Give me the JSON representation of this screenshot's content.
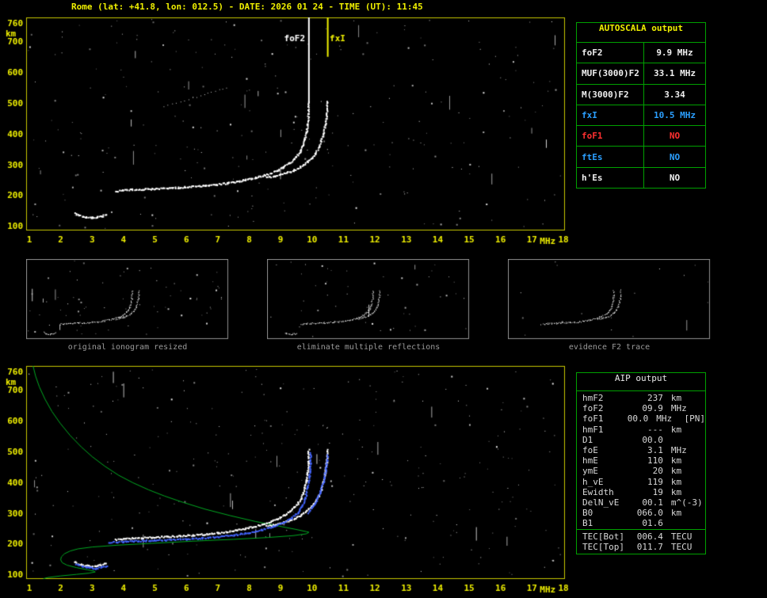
{
  "header": {
    "title": "Rome (lat: +41.8, lon: 012.5) - DATE: 2026 01 24 - TIME (UT): 11:45"
  },
  "panels": {
    "captions": [
      "original ionogram resized",
      "eliminate multiple reflections",
      "evidence F2 trace"
    ]
  },
  "autoscala_table": {
    "title": "AUTOSCALA output",
    "rows": [
      {
        "label": "foF2",
        "value": "9.9 MHz",
        "color": "#f0f0f0"
      },
      {
        "label": "MUF(3000)F2",
        "value": "33.1 MHz",
        "color": "#f0f0f0"
      },
      {
        "label": "M(3000)F2",
        "value": "3.34",
        "color": "#f0f0f0"
      },
      {
        "label": "fxI",
        "value": "10.5 MHz",
        "color": "#2b9fff"
      },
      {
        "label": "foF1",
        "value": "NO",
        "color": "#ff3030"
      },
      {
        "label": "ftEs",
        "value": "NO",
        "color": "#2b9fff"
      },
      {
        "label": "h'Es",
        "value": "NO",
        "color": "#f0f0f0"
      }
    ]
  },
  "aip_table": {
    "title": "AIP output",
    "rows": [
      {
        "label": "hmF2",
        "value": "237",
        "unit": "km"
      },
      {
        "label": "foF2",
        "value": "09.9",
        "unit": "MHz"
      },
      {
        "label": "foF1",
        "value": "00.0",
        "unit": "MHz",
        "extra": "[PN]"
      },
      {
        "label": "hmF1",
        "value": "---",
        "unit": "km"
      },
      {
        "label": "D1",
        "value": "00.0",
        "unit": ""
      },
      {
        "label": "foE",
        "value": "3.1",
        "unit": "MHz"
      },
      {
        "label": "hmE",
        "value": "110",
        "unit": "km"
      },
      {
        "label": "ymE",
        "value": "20",
        "unit": "km"
      },
      {
        "label": "h_vE",
        "value": "119",
        "unit": "km"
      },
      {
        "label": "Ewidth",
        "value": "19",
        "unit": "km"
      },
      {
        "label": "DelN_vE",
        "value": "00.1",
        "unit": "m^(-3)"
      },
      {
        "label": "B0",
        "value": "066.0",
        "unit": "km"
      },
      {
        "label": "B1",
        "value": "01.6",
        "unit": ""
      },
      {
        "label": "TEC[Bot]",
        "value": "006.4",
        "unit": "TECU"
      },
      {
        "label": "TEC[Top]",
        "value": "011.7",
        "unit": "TECU"
      }
    ]
  },
  "chart_data": [
    {
      "id": "main-ionogram",
      "type": "scatter",
      "title": "",
      "xlabel": "MHz",
      "ylabel": "km",
      "xlim": [
        0.9,
        18.05
      ],
      "ylim": [
        85,
        778
      ],
      "x_ticks": [
        1,
        2,
        3,
        4,
        5,
        6,
        7,
        8,
        9,
        10,
        11,
        12,
        13,
        14,
        15,
        16,
        17,
        18
      ],
      "y_ticks": [
        100,
        200,
        300,
        400,
        500,
        600,
        700,
        760
      ],
      "frame_color": "#c8c800",
      "noise": {
        "dots": 265,
        "dashes": 16,
        "seed": 11
      },
      "vlines": [
        {
          "f": 9.9,
          "km0": 500,
          "km1": 778,
          "color": "#ffffff",
          "w": 2
        },
        {
          "f": 10.5,
          "km0": 650,
          "km1": 778,
          "color": "#f0f000",
          "w": 2
        }
      ],
      "annotations": [
        {
          "text": "foF2",
          "f": 9.78,
          "km": 710,
          "color": "#ffffff",
          "align": "right"
        },
        {
          "text": "fxI",
          "f": 10.56,
          "km": 710,
          "color": "#f0f000",
          "align": "left"
        }
      ],
      "traces": [
        {
          "name": "F2-O",
          "color": "#ffffff",
          "width": 2,
          "step": 1.6,
          "points": [
            [
              3.75,
              212
            ],
            [
              4.0,
              215
            ],
            [
              4.3,
              217
            ],
            [
              4.6,
              218
            ],
            [
              5.0,
              220
            ],
            [
              5.4,
              222
            ],
            [
              5.8,
              224
            ],
            [
              6.2,
              227
            ],
            [
              6.6,
              230
            ],
            [
              7.0,
              234
            ],
            [
              7.3,
              238
            ],
            [
              7.6,
              243
            ],
            [
              7.9,
              249
            ],
            [
              8.2,
              256
            ],
            [
              8.5,
              264
            ],
            [
              8.7,
              271
            ],
            [
              8.9,
              280
            ],
            [
              9.1,
              291
            ],
            [
              9.3,
              305
            ],
            [
              9.45,
              318
            ],
            [
              9.55,
              330
            ],
            [
              9.65,
              345
            ],
            [
              9.72,
              362
            ],
            [
              9.78,
              382
            ],
            [
              9.83,
              405
            ],
            [
              9.87,
              432
            ],
            [
              9.89,
              462
            ],
            [
              9.9,
              505
            ]
          ]
        },
        {
          "name": "F2-X",
          "color": "#ffffff",
          "width": 2,
          "step": 1.6,
          "points": [
            [
              8.55,
              256
            ],
            [
              8.8,
              261
            ],
            [
              9.0,
              266
            ],
            [
              9.2,
              272
            ],
            [
              9.45,
              281
            ],
            [
              9.65,
              292
            ],
            [
              9.85,
              306
            ],
            [
              10.0,
              320
            ],
            [
              10.12,
              336
            ],
            [
              10.22,
              355
            ],
            [
              10.3,
              376
            ],
            [
              10.37,
              400
            ],
            [
              10.43,
              430
            ],
            [
              10.47,
              462
            ],
            [
              10.5,
              505
            ]
          ]
        },
        {
          "name": "Es",
          "color": "#ffffff",
          "width": 2,
          "step": 1.6,
          "points": [
            [
              2.45,
              140
            ],
            [
              2.6,
              133
            ],
            [
              2.8,
              128
            ],
            [
              3.0,
              126
            ],
            [
              3.15,
              127
            ],
            [
              3.3,
              130
            ],
            [
              3.45,
              136
            ]
          ]
        },
        {
          "name": "spread",
          "color": "#c8c8c8",
          "width": 1,
          "step": 5,
          "points": [
            [
              5.3,
              487
            ],
            [
              6.2,
              516
            ],
            [
              7.3,
              549
            ]
          ]
        }
      ]
    },
    {
      "id": "resized-ionogram",
      "type": "scatter",
      "xlim": [
        0.9,
        18.05
      ],
      "ylim": [
        85,
        778
      ],
      "frame_color": "#909090",
      "trace_width": 1,
      "noise": {
        "dots": 70,
        "dashes": 4,
        "seed": 41
      },
      "traces_from": 0,
      "trace_names": [
        "F2-O",
        "F2-X",
        "Es"
      ]
    },
    {
      "id": "filtered-ionogram",
      "type": "scatter",
      "xlim": [
        0.9,
        18.05
      ],
      "ylim": [
        85,
        778
      ],
      "frame_color": "#909090",
      "trace_width": 1,
      "noise": {
        "dots": 48,
        "dashes": 2,
        "seed": 42
      },
      "traces_from": 0,
      "trace_names": [
        "F2-O",
        "F2-X",
        "Es"
      ]
    },
    {
      "id": "f2-evidence-ionogram",
      "type": "scatter",
      "xlim": [
        0.9,
        18.05
      ],
      "ylim": [
        85,
        778
      ],
      "frame_color": "#909090",
      "trace_width": 1,
      "noise": {
        "dots": 16,
        "dashes": 1,
        "seed": 43
      },
      "traces_from": 0,
      "trace_names": [
        "F2-O",
        "F2-X"
      ]
    },
    {
      "id": "profile-ionogram",
      "type": "scatter",
      "title": "",
      "xlabel": "MHz",
      "ylabel": "km",
      "xlim": [
        0.9,
        18.05
      ],
      "ylim": [
        85,
        778
      ],
      "x_ticks": [
        1,
        2,
        3,
        4,
        5,
        6,
        7,
        8,
        9,
        10,
        11,
        12,
        13,
        14,
        15,
        16,
        17,
        18
      ],
      "y_ticks": [
        100,
        200,
        300,
        400,
        500,
        600,
        700,
        760
      ],
      "frame_color": "#c8c800",
      "noise": {
        "dots": 295,
        "dashes": 14,
        "seed": 77
      },
      "traces_from": 0,
      "trace_names": [
        "F2-O",
        "F2-X",
        "Es"
      ],
      "traces": [
        {
          "name": "fit-O",
          "color": "#4466ff",
          "width": 2,
          "step": 1.6,
          "points": [
            [
              3.55,
              203
            ],
            [
              4.0,
              206
            ],
            [
              4.5,
              208
            ],
            [
              5.0,
              210
            ],
            [
              5.5,
              212
            ],
            [
              6.0,
              214
            ],
            [
              6.5,
              217
            ],
            [
              7.0,
              221
            ],
            [
              7.5,
              227
            ],
            [
              8.0,
              235
            ],
            [
              8.4,
              244
            ],
            [
              8.8,
              256
            ],
            [
              9.1,
              268
            ],
            [
              9.35,
              283
            ],
            [
              9.55,
              300
            ],
            [
              9.7,
              322
            ],
            [
              9.8,
              350
            ],
            [
              9.87,
              383
            ],
            [
              9.92,
              420
            ],
            [
              9.95,
              458
            ],
            [
              9.96,
              495
            ]
          ]
        },
        {
          "name": "fit-X",
          "color": "#4466ff",
          "width": 2,
          "step": 1.6,
          "points": [
            [
              9.9,
              300
            ],
            [
              10.1,
              330
            ],
            [
              10.25,
              362
            ],
            [
              10.37,
              400
            ],
            [
              10.45,
              442
            ],
            [
              10.5,
              488
            ]
          ]
        },
        {
          "name": "fit-Es",
          "color": "#4466ff",
          "width": 2,
          "step": 1.6,
          "points": [
            [
              2.5,
              133
            ],
            [
              2.7,
              126
            ],
            [
              2.9,
              121
            ],
            [
              3.1,
              119
            ],
            [
              3.3,
              122
            ],
            [
              3.5,
              128
            ]
          ]
        }
      ],
      "lines": [
        {
          "name": "electron-density-profile",
          "color": "#00aa22",
          "width": 1,
          "points": [
            [
              1.12,
              778
            ],
            [
              1.2,
              745
            ],
            [
              1.32,
              710
            ],
            [
              1.5,
              670
            ],
            [
              1.72,
              630
            ],
            [
              1.98,
              592
            ],
            [
              2.3,
              552
            ],
            [
              2.65,
              515
            ],
            [
              3.0,
              483
            ],
            [
              3.4,
              452
            ],
            [
              3.85,
              422
            ],
            [
              4.3,
              398
            ],
            [
              4.8,
              375
            ],
            [
              5.3,
              355
            ],
            [
              5.9,
              334
            ],
            [
              6.6,
              312
            ],
            [
              7.4,
              291
            ],
            [
              8.2,
              272
            ],
            [
              8.9,
              258
            ],
            [
              9.5,
              246
            ],
            [
              9.82,
              239
            ],
            [
              9.9,
              237
            ],
            [
              9.82,
              232
            ],
            [
              9.4,
              226
            ],
            [
              8.6,
              220
            ],
            [
              7.5,
              214
            ],
            [
              6.2,
              208
            ],
            [
              4.9,
              201
            ],
            [
              3.8,
              195
            ],
            [
              3.0,
              189
            ],
            [
              2.55,
              183
            ],
            [
              2.3,
              176
            ],
            [
              2.12,
              167
            ],
            [
              2.02,
              157
            ],
            [
              2.0,
              147
            ],
            [
              2.05,
              138
            ],
            [
              2.2,
              130
            ],
            [
              2.5,
              122
            ],
            [
              2.85,
              115
            ],
            [
              3.05,
              111
            ],
            [
              3.1,
              108
            ],
            [
              2.9,
              104
            ],
            [
              2.5,
              100
            ],
            [
              2.0,
              95
            ],
            [
              1.6,
              90
            ],
            [
              1.45,
              86
            ]
          ]
        }
      ]
    }
  ]
}
